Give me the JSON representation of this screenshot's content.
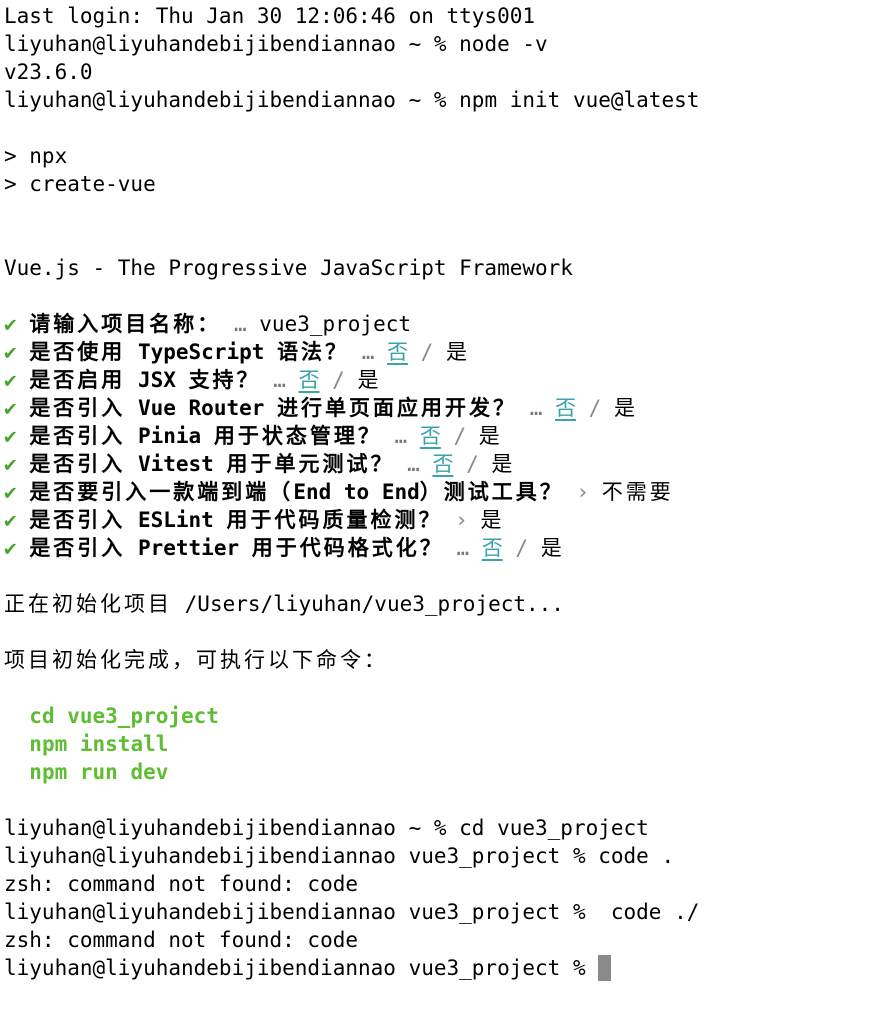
{
  "session": {
    "last_login": "Last login: Thu Jan 30 12:06:46 on ttys001",
    "prompt_home": "liyuhan@liyuhandebijibendiannao ~ % ",
    "prompt_project": "liyuhan@liyuhandebijibendiannao vue3_project % "
  },
  "commands": {
    "node_version_cmd": "node -v",
    "node_version_out": "v23.6.0",
    "npm_init_cmd": "npm init vue@latest",
    "npx_line": "> npx",
    "create_vue_line": "> create-vue",
    "banner": "Vue.js - The Progressive JavaScript Framework",
    "cd_cmd": "cd vue3_project",
    "code_cmd_1": "code .",
    "code_cmd_2": " code ./",
    "not_found": "zsh: command not found: code"
  },
  "wizard": {
    "check_icon": "✔",
    "ellipsis": "…",
    "slash": " / ",
    "no": "否",
    "yes": "是",
    "arrow": "›",
    "q1": "请输入项目名称：",
    "a1": "vue3_project",
    "q2_pre": "是否使用",
    "q2_kw": "TypeScript",
    "q2_post": "语法？",
    "q3_pre": "是否启用",
    "q3_kw": "JSX",
    "q3_post": "支持？",
    "q4_pre": "是否引入",
    "q4_kw": "Vue Router",
    "q4_post": "进行单页面应用开发？",
    "q5_pre": "是否引入",
    "q5_kw": "Pinia",
    "q5_post": "用于状态管理？",
    "q6_pre": "是否引入",
    "q6_kw": "Vitest",
    "q6_post": "用于单元测试？",
    "q7_pre": "是否要引入一款端到端（",
    "q7_kw": "End to End",
    "q7_post": "）测试工具？",
    "a7": "不需要",
    "q8_pre": "是否引入",
    "q8_kw": "ESLint",
    "q8_post": "用于代码质量检测？",
    "q9_pre": "是否引入",
    "q9_kw": "Prettier",
    "q9_post": "用于代码格式化？"
  },
  "progress": {
    "initializing_label": "正在初始化项目",
    "initializing_path": "/Users/liyuhan/vue3_project...",
    "done": "项目初始化完成，可执行以下命令：",
    "next_1": "cd vue3_project",
    "next_2": "npm install",
    "next_3": "npm run dev"
  },
  "colors": {
    "check": "#49a52e",
    "option_no": "#3aa3a9",
    "next_commands": "#5fbd34",
    "cursor": "#8a8a8a"
  }
}
